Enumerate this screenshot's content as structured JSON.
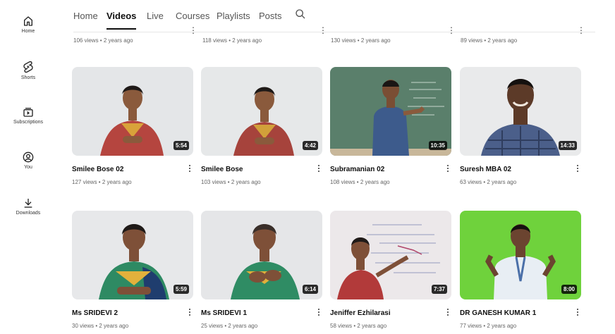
{
  "sidebar": {
    "items": [
      {
        "label": "Home",
        "icon": "home-icon"
      },
      {
        "label": "Shorts",
        "icon": "shorts-icon"
      },
      {
        "label": "Subscriptions",
        "icon": "subscriptions-icon"
      },
      {
        "label": "You",
        "icon": "you-icon"
      },
      {
        "label": "Downloads",
        "icon": "download-icon"
      }
    ]
  },
  "tabs": {
    "items": [
      "Home",
      "Videos",
      "Live",
      "Courses",
      "Playlists",
      "Posts"
    ],
    "active": "Videos",
    "search_icon": "search-icon"
  },
  "top_row": {
    "meta": [
      "106 views • 2 years ago",
      "118 views • 2 years ago",
      "130 views • 2 years ago",
      "89 views • 2 years ago"
    ]
  },
  "videos": [
    {
      "title": "Smilee Bose 02",
      "meta": "127 views • 2 years ago",
      "duration": "5:54"
    },
    {
      "title": "Smilee Bose",
      "meta": "103 views • 2 years ago",
      "duration": "4:42"
    },
    {
      "title": "Subramanian 02",
      "meta": "108 views • 2 years ago",
      "duration": "10:35"
    },
    {
      "title": "Suresh MBA 02",
      "meta": "63 views • 2 years ago",
      "duration": "14:33"
    },
    {
      "title": "Ms SRIDEVI 2",
      "meta": "30 views • 2 years ago",
      "duration": "5:59"
    },
    {
      "title": "Ms SRIDEVI 1",
      "meta": "25 views • 2 years ago",
      "duration": "6:14"
    },
    {
      "title": "Jeniffer Ezhilarasi",
      "meta": "58 views • 2 years ago",
      "duration": "7:37"
    },
    {
      "title": "DR GANESH KUMAR 1",
      "meta": "77 views • 2 years ago",
      "duration": "8:00"
    }
  ],
  "colors": {
    "thumb_wall": "#e4e6e8",
    "chalkboard": "#5a7f6b",
    "whiteboard": "#ece8ea",
    "green_screen": "#6fd23c",
    "saree_red": "#b5453f",
    "saree_green": "#2e8a63"
  }
}
